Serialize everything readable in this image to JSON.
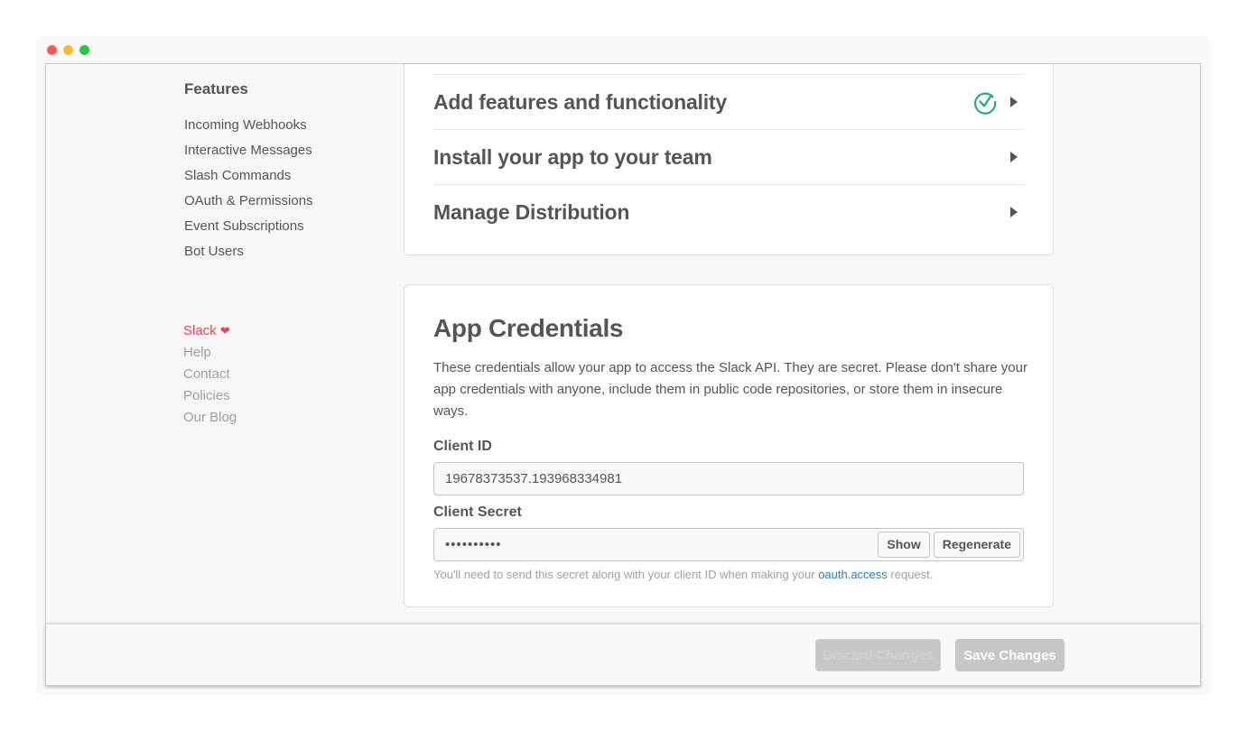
{
  "window": {
    "controls": [
      "close",
      "minimize",
      "maximize"
    ]
  },
  "sidebar": {
    "section_title": "Features",
    "feature_items": [
      {
        "label": "Incoming Webhooks"
      },
      {
        "label": "Interactive Messages"
      },
      {
        "label": "Slash Commands"
      },
      {
        "label": "OAuth & Permissions"
      },
      {
        "label": "Event Subscriptions"
      },
      {
        "label": "Bot Users"
      }
    ],
    "footer_links": [
      {
        "label": "Slack",
        "icon": "heart-icon"
      },
      {
        "label": "Help"
      },
      {
        "label": "Contact"
      },
      {
        "label": "Policies"
      },
      {
        "label": "Our Blog"
      }
    ],
    "footer_accent": "#e8435a"
  },
  "steps": [
    {
      "title": "Add features and functionality",
      "completed": true,
      "icon": "check-circle-icon"
    },
    {
      "title": "Install your app to your team",
      "completed": false
    },
    {
      "title": "Manage Distribution",
      "completed": false
    }
  ],
  "credentials": {
    "title": "App Credentials",
    "description": "These credentials allow your app to access the Slack API. They are secret. Please don't share your app credentials with anyone, include them in public code repositories, or store them in insecure ways.",
    "client_id_label": "Client ID",
    "client_id_value": "19678373537.193968334981",
    "client_secret_label": "Client Secret",
    "client_secret_masked": "••••••••••",
    "show_label": "Show",
    "regenerate_label": "Regenerate",
    "hint_prefix": "You'll need to send this secret along with your client ID when making your ",
    "hint_link": "oauth.access",
    "hint_suffix": " request."
  },
  "footer": {
    "discard_label": "Discard Changes",
    "save_label": "Save Changes"
  },
  "colors": {
    "success": "#2bac76",
    "link": "#2a80b9",
    "text": "#555459",
    "muted": "#9e9ea6"
  }
}
